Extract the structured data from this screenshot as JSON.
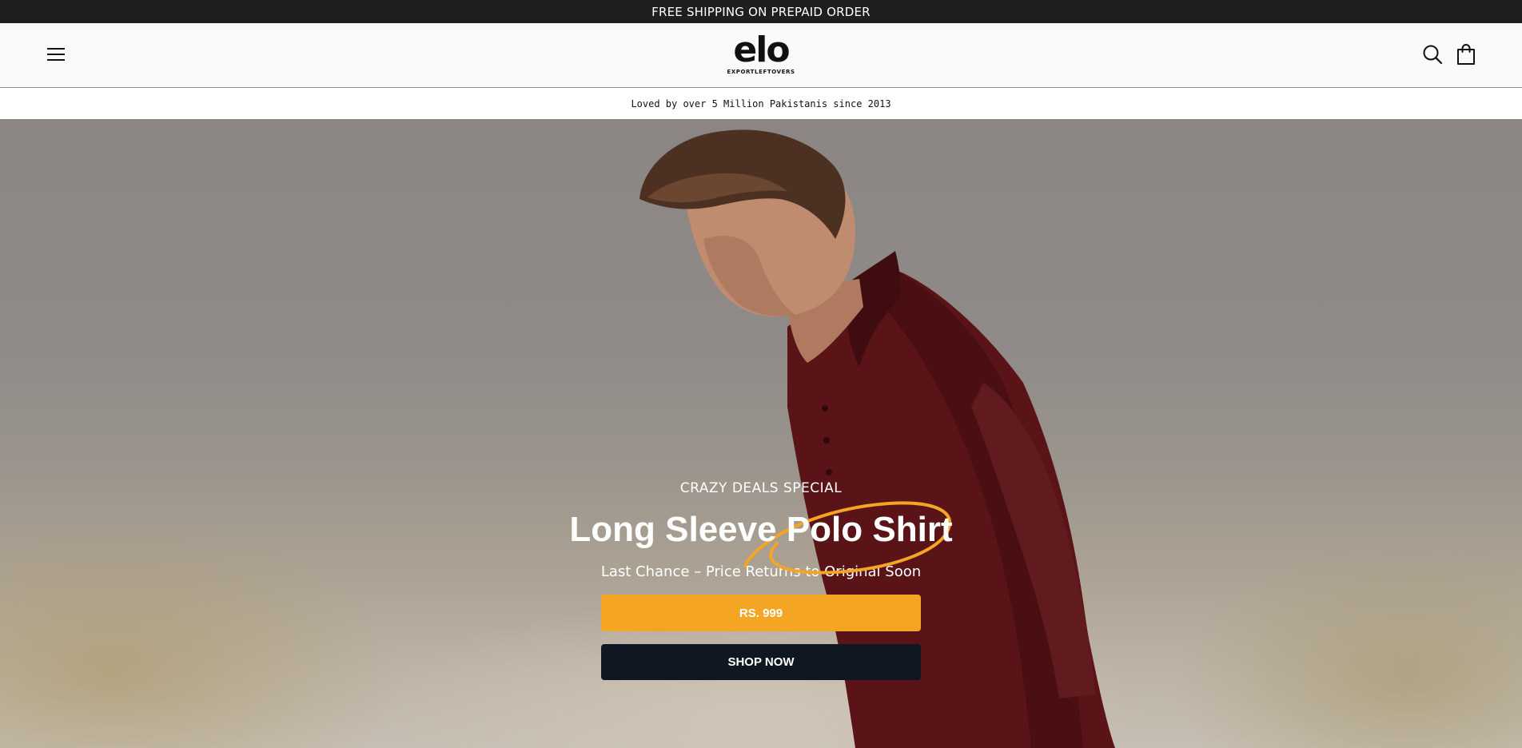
{
  "announcement": {
    "text": "FREE SHIPPING ON PREPAID ORDER"
  },
  "header": {
    "logo_word": "elo",
    "logo_sub": "EXPORTLEFTOVERS",
    "menu_icon": "hamburger-menu-icon",
    "search_icon": "search-icon",
    "cart_icon": "shopping-bag-icon"
  },
  "tagline": {
    "text": "Loved by over 5 Million Pakistanis since 2013"
  },
  "hero": {
    "eyebrow": "CRAZY DEALS SPECIAL",
    "headline": "Long Sleeve Polo Shirt",
    "subline": "Last Chance – Price Returns to Original Soon",
    "price_label": "RS. 999",
    "cta_label": "SHOP NOW",
    "accent_color": "#f4a524",
    "cta_color": "#0f1822"
  }
}
